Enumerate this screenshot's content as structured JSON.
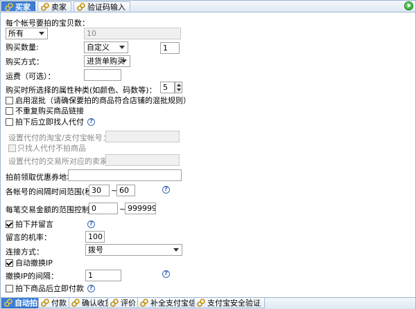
{
  "tabs_top": [
    {
      "label": "买家",
      "icon": "link-icon"
    },
    {
      "label": "卖家",
      "icon": "link-icon"
    },
    {
      "label": "验证码输入",
      "icon": "link-icon"
    }
  ],
  "form": {
    "accounts_label": "每个帐号要拍的宝贝数：",
    "accounts_select": "所有",
    "accounts_count": "10",
    "qty_label": "购买数量:",
    "qty_select": "自定义",
    "qty_value": "1",
    "method_label": "购买方式：",
    "method_select": "进货单购买",
    "shipping_label": "运费（可选）：",
    "shipping_value": "",
    "attr_label": "购买时所选择的属性种类(如颜色、码数等)：",
    "attr_value": "5",
    "mix_label": "启用混批（请确保要拍的商品符合店铺的混批规则）",
    "norepeat_label": "不重复购买商品链接",
    "proxy_label": "拍下后立即找人代付",
    "proxy_account_label": "设置代付的淘宝/支付宝帐号：",
    "proxy_only_label": "只找人代付不拍商品",
    "proxy_wangwang_label": "设置代付的交易所对应的卖家旺旺ID",
    "coupon_label": "拍前领取优惠券地址：",
    "interval_label": "各帐号的间隔时间范围(秒)：",
    "interval_min": "30",
    "interval_sep": "~",
    "interval_max": "60",
    "amount_label": "每笔交易金额的范围控制在：",
    "amount_min": "0",
    "amount_sep": "~",
    "amount_max": "9999999",
    "leave_msg_label": "拍下并留言",
    "msg_prob_label": "留言的机率：",
    "msg_prob_value": "100",
    "conn_label": "连接方式：",
    "conn_select": "拨号",
    "autoip_label": "自动撤换IP",
    "ip_interval_label": "撤换IP的间隔：",
    "ip_interval_value": "1",
    "pay_label": "拍下商品后立即付款",
    "help_glyph": "?"
  },
  "tabs_bottom": [
    {
      "label": "自动拍",
      "icon": "link-icon"
    },
    {
      "label": "付款",
      "icon": "link-icon"
    },
    {
      "label": "确认收货",
      "icon": "link-icon"
    },
    {
      "label": "评价",
      "icon": "link-icon"
    },
    {
      "label": "补全支付宝信息",
      "icon": "link-icon"
    },
    {
      "label": "支付宝安全验证",
      "icon": "link-icon"
    }
  ],
  "colors": {
    "accent": "#3c7fd6",
    "help": "#3568b5",
    "play": "#1f9b1f"
  }
}
